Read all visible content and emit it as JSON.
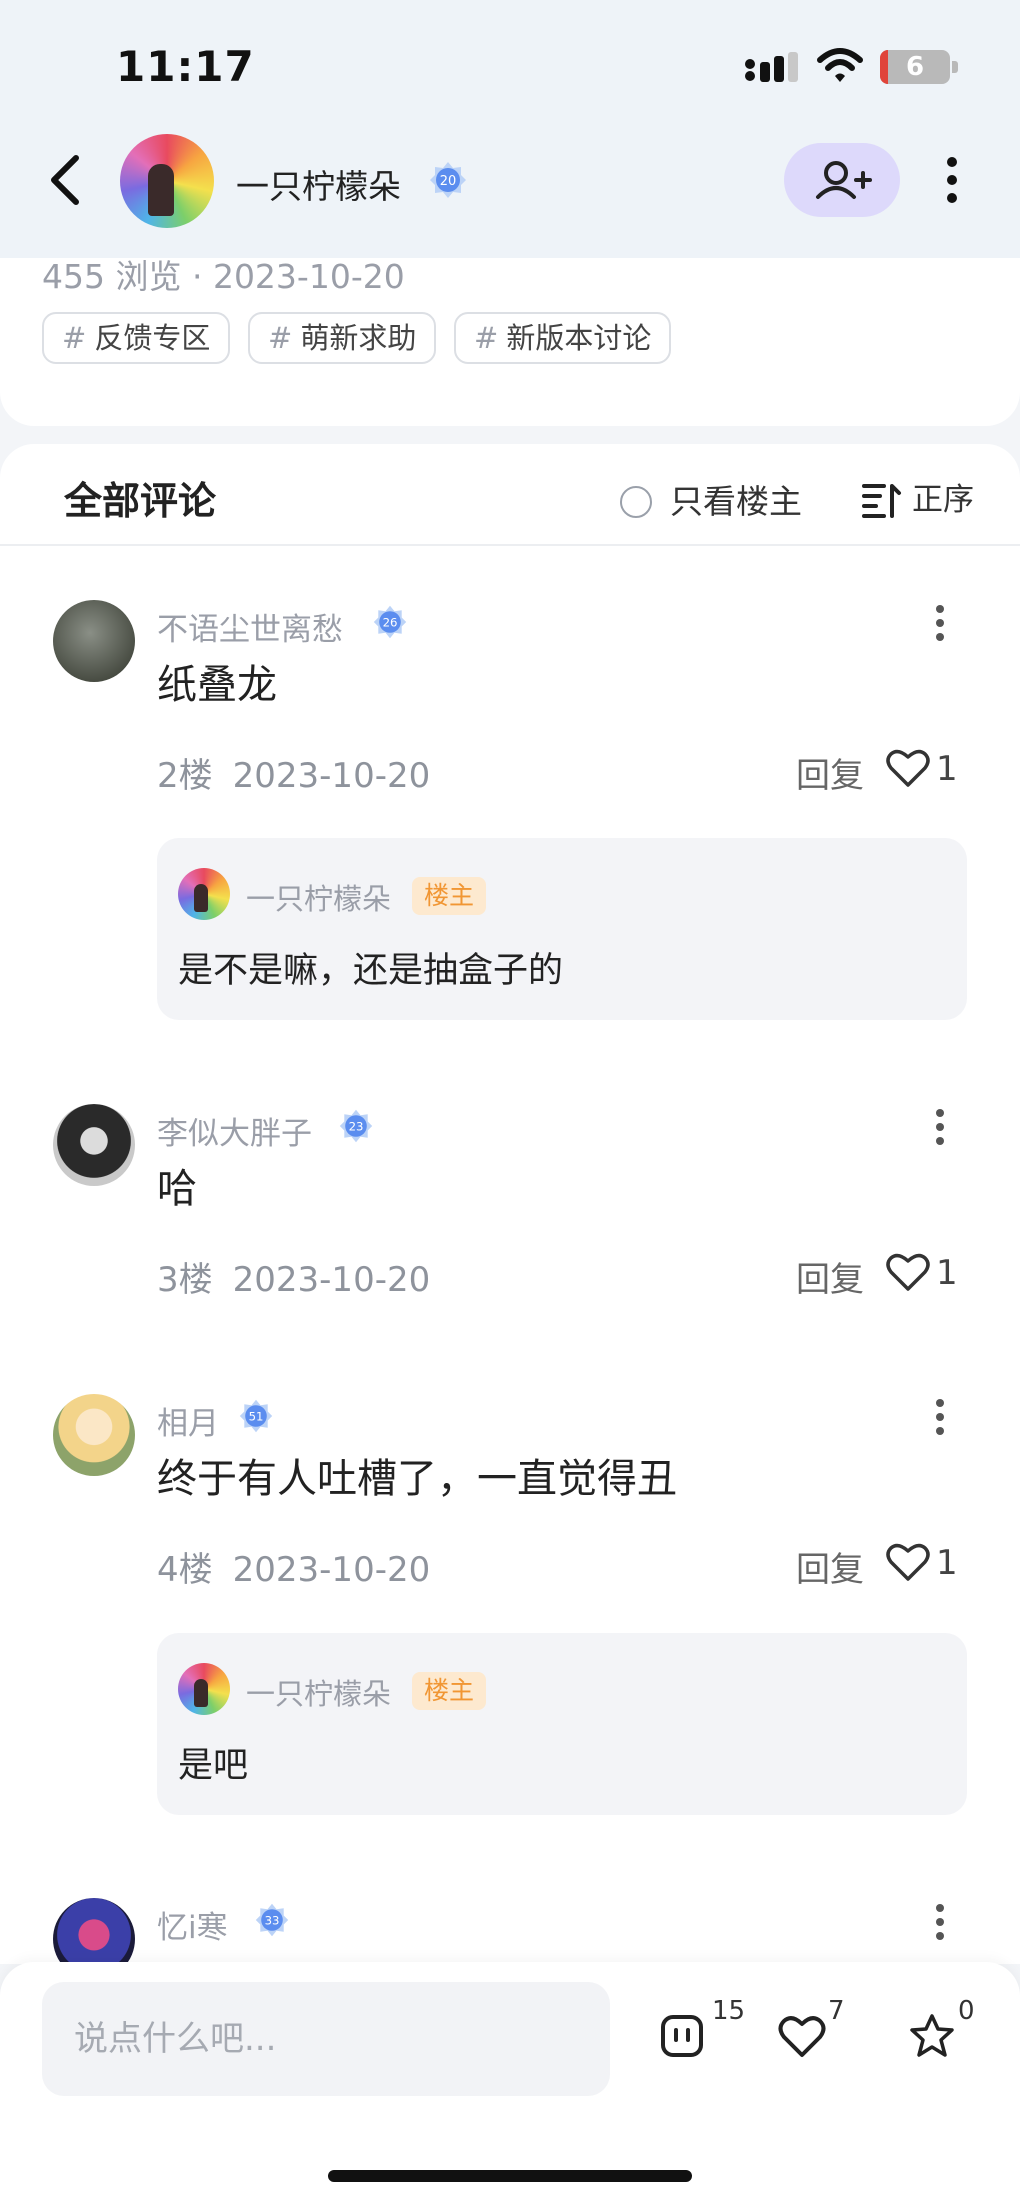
{
  "status_bar": {
    "time": "11:17",
    "battery": "6"
  },
  "header": {
    "username": "一只柠檬朵",
    "level": "20"
  },
  "post": {
    "meta": "455 浏览 · 2023-10-20",
    "tags": [
      {
        "hash": "#",
        "label": "反馈专区"
      },
      {
        "hash": "#",
        "label": "萌新求助"
      },
      {
        "hash": "#",
        "label": "新版本讨论"
      }
    ]
  },
  "comments_section": {
    "title": "全部评论",
    "only_host": "只看楼主",
    "sort": "正序"
  },
  "comments": [
    {
      "user": "不语尘世离愁",
      "level": "26",
      "text": "纸叠龙",
      "floor": "2楼",
      "date": "2023-10-20",
      "reply_label": "回复",
      "likes": "1",
      "sub": {
        "user": "一只柠檬朵",
        "badge": "楼主",
        "text": "是不是嘛，还是抽盒子的"
      }
    },
    {
      "user": "李似大胖子",
      "level": "23",
      "text": "哈",
      "floor": "3楼",
      "date": "2023-10-20",
      "reply_label": "回复",
      "likes": "1"
    },
    {
      "user": "相月",
      "level": "51",
      "text": "终于有人吐槽了，一直觉得丑",
      "floor": "4楼",
      "date": "2023-10-20",
      "reply_label": "回复",
      "likes": "1",
      "sub": {
        "user": "一只柠檬朵",
        "badge": "楼主",
        "text": "是吧"
      }
    },
    {
      "user": "忆i寒",
      "level": "33"
    }
  ],
  "bottom_bar": {
    "input_placeholder": "说点什么吧...",
    "comments_count": "15",
    "likes_count": "7",
    "stars_count": "0"
  },
  "colors": {
    "accent_purple": "#ddd9fb",
    "owner_badge": "#f19633",
    "level_badge": "#5b8def"
  }
}
